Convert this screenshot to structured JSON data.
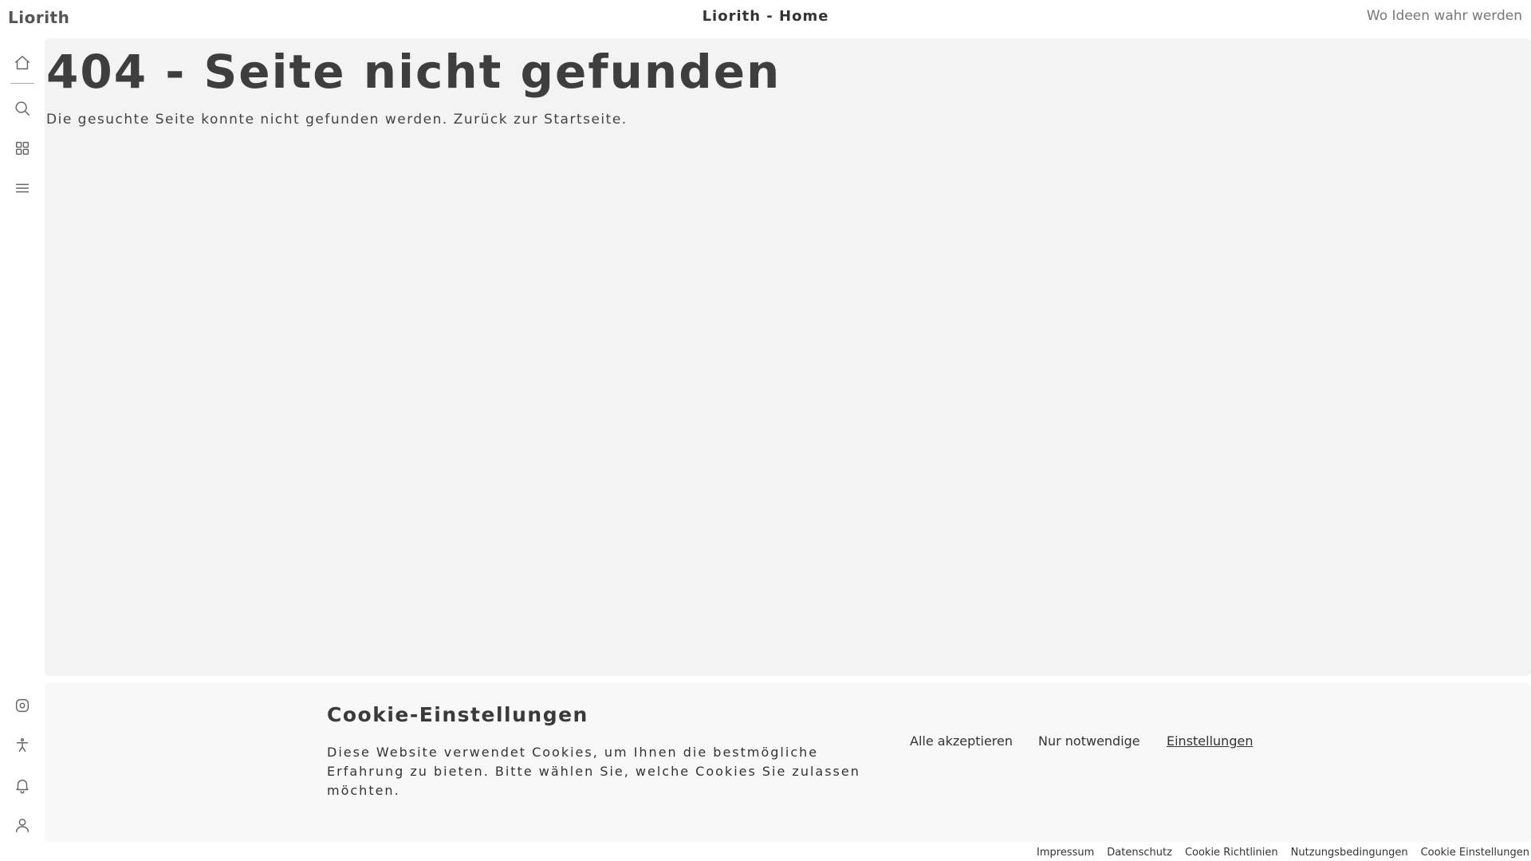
{
  "header": {
    "brand": "Liorith",
    "title": "Liorith - Home",
    "tagline": "Wo Ideen wahr werden"
  },
  "sidebar": {
    "top_icons": [
      "home-icon",
      "search-icon",
      "grid-icon",
      "menu-icon"
    ],
    "bottom_icons": [
      "settings-icon",
      "accessibility-icon",
      "bell-icon",
      "user-icon"
    ]
  },
  "main": {
    "heading": "404 - Seite nicht gefunden",
    "description": "Die gesuchte Seite konnte nicht gefunden werden. Zurück zur Startseite."
  },
  "cookie_banner": {
    "title": "Cookie-Einstellungen",
    "text": "Diese Website verwendet Cookies, um Ihnen die bestmögliche Erfahrung zu bieten. Bitte wählen Sie, welche Cookies Sie zulassen möchten.",
    "accept_all": "Alle akzeptieren",
    "only_necessary": "Nur notwendige",
    "settings": "Einstellungen"
  },
  "footer": {
    "links": [
      "Impressum",
      "Datenschutz",
      "Cookie Richtlinien",
      "Nutzungsbedingungen",
      "Cookie Einstellungen"
    ]
  },
  "colors": {
    "main_bg": "#f3f3f3",
    "cookie_bg": "#f8f8f8",
    "text": "#3e3e3e"
  }
}
